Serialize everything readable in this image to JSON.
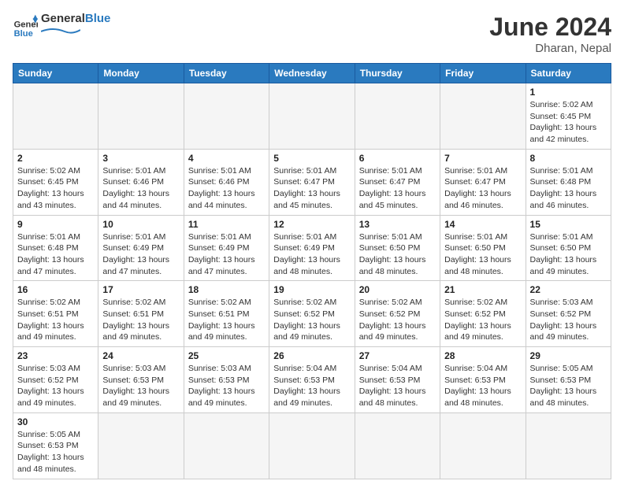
{
  "header": {
    "logo_general": "General",
    "logo_blue": "Blue",
    "month_year": "June 2024",
    "location": "Dharan, Nepal"
  },
  "weekdays": [
    "Sunday",
    "Monday",
    "Tuesday",
    "Wednesday",
    "Thursday",
    "Friday",
    "Saturday"
  ],
  "weeks": [
    [
      {
        "day": "",
        "info": ""
      },
      {
        "day": "",
        "info": ""
      },
      {
        "day": "",
        "info": ""
      },
      {
        "day": "",
        "info": ""
      },
      {
        "day": "",
        "info": ""
      },
      {
        "day": "",
        "info": ""
      },
      {
        "day": "1",
        "info": "Sunrise: 5:02 AM\nSunset: 6:45 PM\nDaylight: 13 hours\nand 42 minutes."
      }
    ],
    [
      {
        "day": "2",
        "info": "Sunrise: 5:02 AM\nSunset: 6:45 PM\nDaylight: 13 hours\nand 43 minutes."
      },
      {
        "day": "3",
        "info": "Sunrise: 5:01 AM\nSunset: 6:46 PM\nDaylight: 13 hours\nand 44 minutes."
      },
      {
        "day": "4",
        "info": "Sunrise: 5:01 AM\nSunset: 6:46 PM\nDaylight: 13 hours\nand 44 minutes."
      },
      {
        "day": "5",
        "info": "Sunrise: 5:01 AM\nSunset: 6:47 PM\nDaylight: 13 hours\nand 45 minutes."
      },
      {
        "day": "6",
        "info": "Sunrise: 5:01 AM\nSunset: 6:47 PM\nDaylight: 13 hours\nand 45 minutes."
      },
      {
        "day": "7",
        "info": "Sunrise: 5:01 AM\nSunset: 6:47 PM\nDaylight: 13 hours\nand 46 minutes."
      },
      {
        "day": "8",
        "info": "Sunrise: 5:01 AM\nSunset: 6:48 PM\nDaylight: 13 hours\nand 46 minutes."
      }
    ],
    [
      {
        "day": "9",
        "info": "Sunrise: 5:01 AM\nSunset: 6:48 PM\nDaylight: 13 hours\nand 47 minutes."
      },
      {
        "day": "10",
        "info": "Sunrise: 5:01 AM\nSunset: 6:49 PM\nDaylight: 13 hours\nand 47 minutes."
      },
      {
        "day": "11",
        "info": "Sunrise: 5:01 AM\nSunset: 6:49 PM\nDaylight: 13 hours\nand 47 minutes."
      },
      {
        "day": "12",
        "info": "Sunrise: 5:01 AM\nSunset: 6:49 PM\nDaylight: 13 hours\nand 48 minutes."
      },
      {
        "day": "13",
        "info": "Sunrise: 5:01 AM\nSunset: 6:50 PM\nDaylight: 13 hours\nand 48 minutes."
      },
      {
        "day": "14",
        "info": "Sunrise: 5:01 AM\nSunset: 6:50 PM\nDaylight: 13 hours\nand 48 minutes."
      },
      {
        "day": "15",
        "info": "Sunrise: 5:01 AM\nSunset: 6:50 PM\nDaylight: 13 hours\nand 49 minutes."
      }
    ],
    [
      {
        "day": "16",
        "info": "Sunrise: 5:02 AM\nSunset: 6:51 PM\nDaylight: 13 hours\nand 49 minutes."
      },
      {
        "day": "17",
        "info": "Sunrise: 5:02 AM\nSunset: 6:51 PM\nDaylight: 13 hours\nand 49 minutes."
      },
      {
        "day": "18",
        "info": "Sunrise: 5:02 AM\nSunset: 6:51 PM\nDaylight: 13 hours\nand 49 minutes."
      },
      {
        "day": "19",
        "info": "Sunrise: 5:02 AM\nSunset: 6:52 PM\nDaylight: 13 hours\nand 49 minutes."
      },
      {
        "day": "20",
        "info": "Sunrise: 5:02 AM\nSunset: 6:52 PM\nDaylight: 13 hours\nand 49 minutes."
      },
      {
        "day": "21",
        "info": "Sunrise: 5:02 AM\nSunset: 6:52 PM\nDaylight: 13 hours\nand 49 minutes."
      },
      {
        "day": "22",
        "info": "Sunrise: 5:03 AM\nSunset: 6:52 PM\nDaylight: 13 hours\nand 49 minutes."
      }
    ],
    [
      {
        "day": "23",
        "info": "Sunrise: 5:03 AM\nSunset: 6:52 PM\nDaylight: 13 hours\nand 49 minutes."
      },
      {
        "day": "24",
        "info": "Sunrise: 5:03 AM\nSunset: 6:53 PM\nDaylight: 13 hours\nand 49 minutes."
      },
      {
        "day": "25",
        "info": "Sunrise: 5:03 AM\nSunset: 6:53 PM\nDaylight: 13 hours\nand 49 minutes."
      },
      {
        "day": "26",
        "info": "Sunrise: 5:04 AM\nSunset: 6:53 PM\nDaylight: 13 hours\nand 49 minutes."
      },
      {
        "day": "27",
        "info": "Sunrise: 5:04 AM\nSunset: 6:53 PM\nDaylight: 13 hours\nand 48 minutes."
      },
      {
        "day": "28",
        "info": "Sunrise: 5:04 AM\nSunset: 6:53 PM\nDaylight: 13 hours\nand 48 minutes."
      },
      {
        "day": "29",
        "info": "Sunrise: 5:05 AM\nSunset: 6:53 PM\nDaylight: 13 hours\nand 48 minutes."
      }
    ],
    [
      {
        "day": "30",
        "info": "Sunrise: 5:05 AM\nSunset: 6:53 PM\nDaylight: 13 hours\nand 48 minutes."
      },
      {
        "day": "",
        "info": ""
      },
      {
        "day": "",
        "info": ""
      },
      {
        "day": "",
        "info": ""
      },
      {
        "day": "",
        "info": ""
      },
      {
        "day": "",
        "info": ""
      },
      {
        "day": "",
        "info": ""
      }
    ]
  ]
}
